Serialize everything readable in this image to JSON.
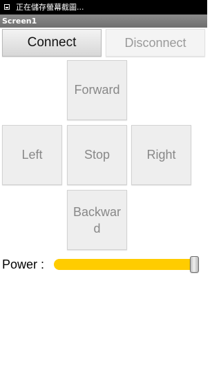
{
  "status_bar": {
    "text": "正在儲存螢幕截圖..."
  },
  "title_bar": {
    "title": "Screen1"
  },
  "buttons": {
    "connect": "Connect",
    "disconnect": "Disconnect",
    "forward": "Forward",
    "left": "Left",
    "stop": "Stop",
    "right": "Right",
    "backward": "Backward"
  },
  "power": {
    "label": "Power :",
    "value_fraction": 0.96,
    "track_color": "#ffcc00"
  },
  "icons": {
    "status_notification": "image-icon"
  }
}
